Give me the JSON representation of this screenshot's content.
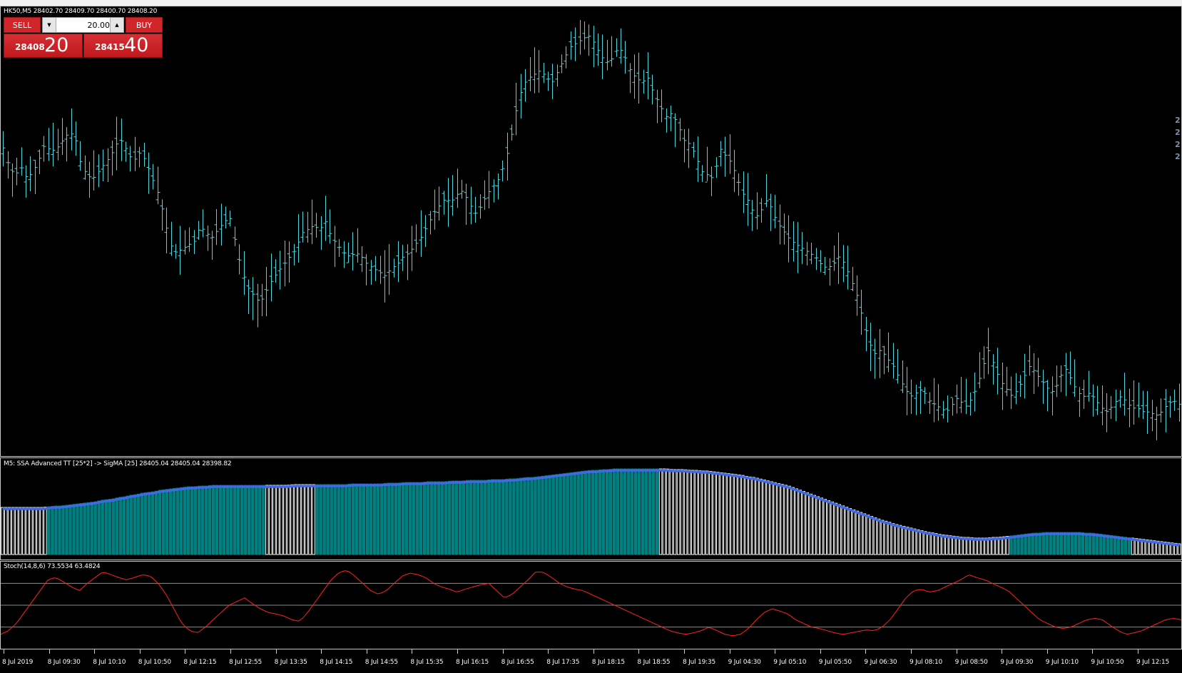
{
  "window": {
    "symbol_info": "HK50,M5  28402.70 28409.70 28400.70 28408.20"
  },
  "trade_panel": {
    "sell_label": "SELL",
    "buy_label": "BUY",
    "lot_value": "20.00",
    "sell_price_main": "28408",
    "sell_price_big": "20",
    "buy_price_main": "28415",
    "buy_price_big": "40",
    "colors": {
      "panel_red": "#d0262a"
    }
  },
  "right_price_labels": [
    "2",
    "2",
    "2",
    "2"
  ],
  "indicators": {
    "ssa_label": "M5: SSA Advanced TT [25*2] -> SigMA [25] 28405.04 28405.04 28398.82",
    "stoch_label": "Stoch(14,8,6) 73.5534 63.4824"
  },
  "time_axis": {
    "labels": [
      "8 Jul 2019",
      "8 Jul 09:30",
      "8 Jul 10:10",
      "8 Jul 10:50",
      "8 Jul 12:15",
      "8 Jul 12:55",
      "8 Jul 13:35",
      "8 Jul 14:15",
      "8 Jul 14:55",
      "8 Jul 15:35",
      "8 Jul 16:15",
      "8 Jul 16:55",
      "8 Jul 17:35",
      "8 Jul 18:15",
      "8 Jul 18:55",
      "8 Jul 19:35",
      "9 Jul 04:30",
      "9 Jul 05:10",
      "9 Jul 05:50",
      "9 Jul 06:30",
      "9 Jul 08:10",
      "9 Jul 08:50",
      "9 Jul 09:30",
      "9 Jul 10:10",
      "9 Jul 10:50",
      "9 Jul 12:15"
    ]
  },
  "chart_data": [
    {
      "type": "ohlc",
      "symbol": "HK50,M5",
      "bar_color": "#4fd7e0",
      "background": "#000000",
      "closes": [
        340,
        315,
        305,
        315,
        300,
        310,
        325,
        345,
        335,
        340,
        350,
        360,
        355,
        320,
        305,
        300,
        310,
        320,
        330,
        345,
        350,
        330,
        325,
        335,
        320,
        300,
        280,
        250,
        215,
        205,
        210,
        215,
        220,
        240,
        230,
        225,
        235,
        245,
        250,
        215,
        180,
        160,
        150,
        140,
        155,
        170,
        180,
        190,
        200,
        210,
        230,
        235,
        240,
        235,
        245,
        225,
        215,
        205,
        200,
        205,
        200,
        190,
        185,
        180,
        175,
        185,
        190,
        200,
        205,
        215,
        225,
        240,
        255,
        265,
        275,
        270,
        280,
        285,
        270,
        255,
        265,
        280,
        290,
        300,
        320,
        350,
        390,
        420,
        430,
        435,
        440,
        430,
        425,
        440,
        455,
        470,
        475,
        480,
        485,
        475,
        460,
        450,
        455,
        470,
        460,
        440,
        430,
        425,
        430,
        410,
        395,
        380,
        385,
        370,
        350,
        345,
        330,
        310,
        305,
        300,
        340,
        330,
        320,
        300,
        280,
        270,
        250,
        260,
        275,
        255,
        240,
        230,
        220,
        215,
        210,
        205,
        200,
        190,
        185,
        190,
        200,
        190,
        170,
        150,
        120,
        90,
        75,
        80,
        70,
        60,
        45,
        30,
        20,
        25,
        30,
        15,
        10,
        5,
        0,
        10,
        20,
        5,
        15,
        30,
        55,
        80,
        60,
        40,
        30,
        20,
        30,
        45,
        60,
        50,
        40,
        30,
        25,
        45,
        55,
        40,
        25,
        20,
        25,
        15,
        5,
        0,
        10,
        20,
        15,
        5,
        5,
        0,
        0,
        -5,
        0,
        10,
        15,
        10
      ]
    },
    {
      "type": "histogram+line",
      "title": "M5: SSA Advanced TT [25*2] -> SigMA [25]",
      "values_shown": [
        28405.04,
        28405.04,
        28398.82
      ],
      "up_color": "#008080",
      "down_color": "#ffffff",
      "line_color": "#4169e1",
      "values": [
        66,
        66,
        66,
        66,
        66,
        66,
        66,
        66,
        67,
        68,
        68,
        69,
        70,
        71,
        72,
        73,
        74,
        76,
        77,
        78,
        80,
        81,
        83,
        84,
        86,
        87,
        88,
        90,
        91,
        92,
        93,
        94,
        95,
        95,
        96,
        96,
        97,
        97,
        97,
        97,
        97,
        97,
        97,
        97,
        97,
        97,
        97,
        97,
        97,
        97,
        98,
        98,
        98,
        98,
        98,
        98,
        98,
        98,
        98,
        98,
        99,
        99,
        99,
        99,
        99,
        99,
        100,
        100,
        100,
        101,
        101,
        101,
        101,
        102,
        102,
        102,
        102,
        103,
        103,
        103,
        104,
        104,
        104,
        104,
        105,
        105,
        105,
        106,
        106,
        107,
        108,
        108,
        109,
        110,
        111,
        112,
        113,
        114,
        115,
        116,
        117,
        118,
        118,
        119,
        119,
        120,
        120,
        120,
        120,
        120,
        120,
        120,
        120,
        120,
        120,
        119,
        119,
        119,
        118,
        118,
        117,
        117,
        116,
        115,
        114,
        113,
        112,
        111,
        109,
        108,
        106,
        104,
        102,
        100,
        98,
        96,
        93,
        90,
        87,
        84,
        81,
        78,
        75,
        72,
        69,
        66,
        63,
        60,
        57,
        54,
        51,
        48,
        46,
        43,
        41,
        39,
        37,
        35,
        33,
        31,
        30,
        28,
        27,
        26,
        25,
        24,
        24,
        23,
        23,
        23,
        24,
        24,
        25,
        26,
        27,
        28,
        29,
        30,
        30,
        31,
        31,
        31,
        31,
        31,
        31,
        31,
        30,
        30,
        29,
        28,
        27,
        26,
        25,
        24,
        23,
        22,
        21,
        20,
        19,
        18,
        17,
        16,
        15
      ],
      "up_mask_ranges": [
        [
          13,
          73
        ],
        [
          88,
          183
        ],
        [
          282,
          315
        ]
      ]
    },
    {
      "type": "line",
      "title": "Stoch(14,8,6)",
      "values_shown": [
        73.5534,
        63.4824
      ],
      "line_color": "#ff2020",
      "levels": [
        80,
        50,
        20
      ],
      "ylim": [
        0,
        100
      ],
      "values": [
        10,
        15,
        25,
        40,
        55,
        70,
        85,
        88,
        82,
        75,
        70,
        80,
        88,
        96,
        92,
        88,
        85,
        88,
        92,
        90,
        80,
        65,
        45,
        25,
        15,
        12,
        20,
        30,
        40,
        50,
        55,
        60,
        52,
        45,
        40,
        38,
        35,
        30,
        28,
        40,
        55,
        70,
        85,
        95,
        98,
        90,
        80,
        70,
        65,
        70,
        80,
        90,
        94,
        92,
        88,
        80,
        75,
        72,
        68,
        72,
        75,
        78,
        80,
        70,
        60,
        65,
        75,
        85,
        96,
        95,
        88,
        80,
        75,
        72,
        70,
        65,
        60,
        55,
        50,
        45,
        40,
        35,
        30,
        25,
        20,
        15,
        12,
        10,
        12,
        15,
        20,
        15,
        10,
        8,
        10,
        18,
        30,
        40,
        45,
        42,
        38,
        30,
        25,
        20,
        18,
        15,
        12,
        10,
        12,
        14,
        16,
        15,
        20,
        30,
        45,
        60,
        70,
        72,
        68,
        70,
        75,
        80,
        85,
        92,
        88,
        85,
        80,
        75,
        70,
        60,
        50,
        40,
        30,
        25,
        20,
        18,
        20,
        25,
        30,
        32,
        30,
        22,
        15,
        10,
        12,
        15,
        20,
        25,
        30,
        32,
        30
      ]
    }
  ]
}
